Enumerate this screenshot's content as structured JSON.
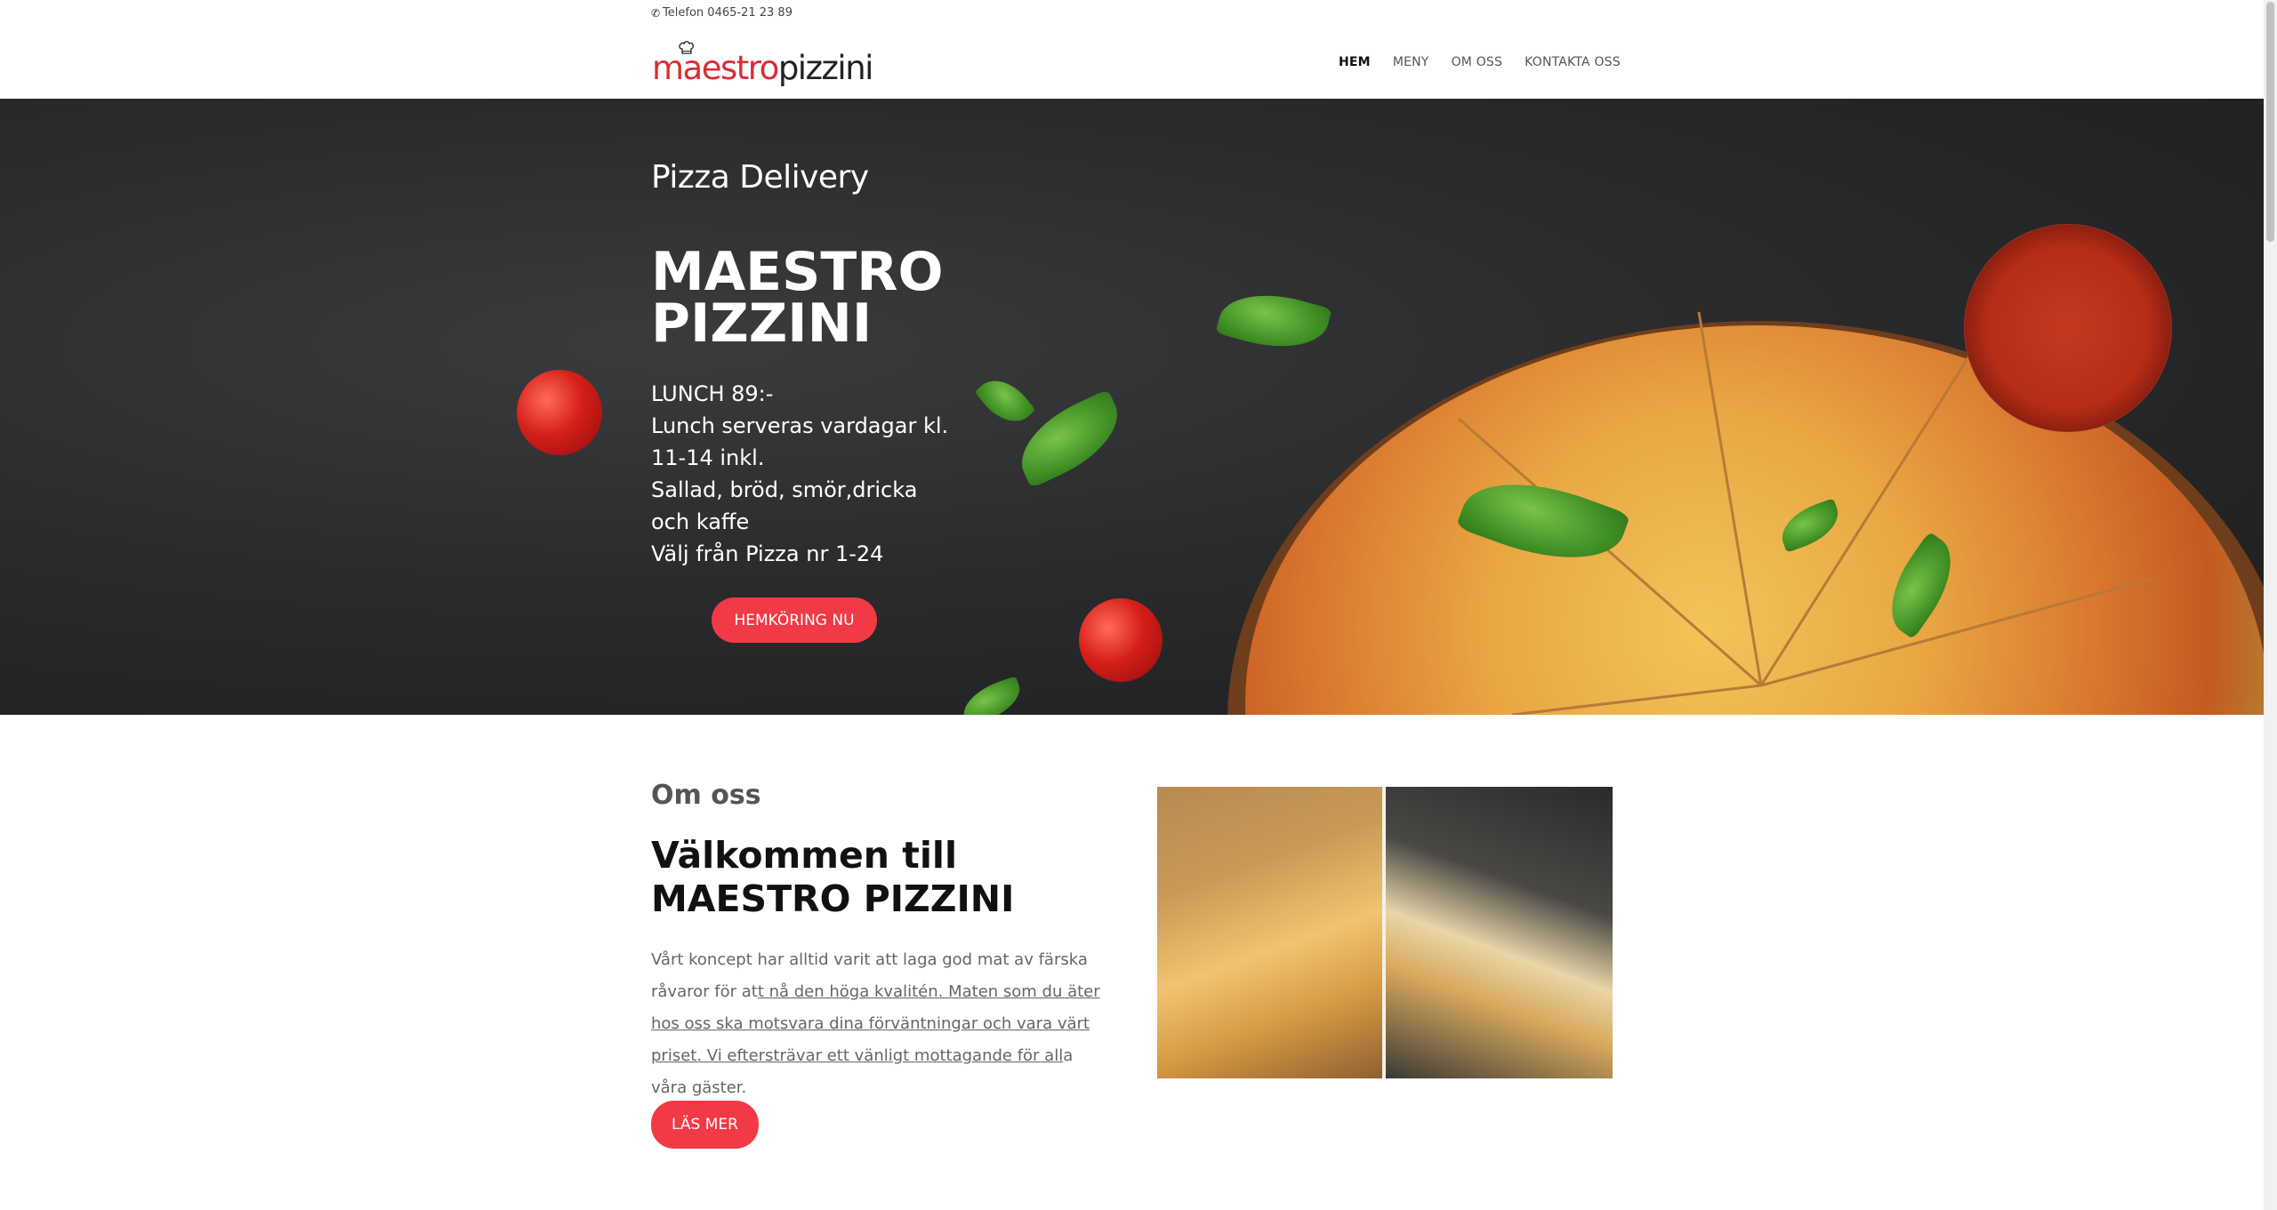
{
  "topbar": {
    "phone": "Telefon 0465-21 23 89"
  },
  "header": {
    "logo_part1": "maestro",
    "logo_part2": "pizzini",
    "nav": [
      {
        "label": "HEM",
        "active": true
      },
      {
        "label": "MENY"
      },
      {
        "label": "OM OSS"
      },
      {
        "label": "KONTAKTA OSS"
      }
    ]
  },
  "hero": {
    "subtitle": "Pizza Delivery",
    "title_line1": "MAESTRO",
    "title_line2": "PIZZINI",
    "lines": [
      "LUNCH 89:-",
      "Lunch serveras vardagar kl. 11-14 inkl.",
      "Sallad, bröd, smör,dricka och kaffe",
      "Välj från Pizza nr 1-24"
    ],
    "button": "HEMKÖRING NU"
  },
  "about": {
    "kicker": "Om oss",
    "title_line1": "Välkommen till",
    "title_line2": "MAESTRO PIZZINI",
    "text_a": "Vårt koncept har alltid varit att laga god mat av färska råvaror för at",
    "text_b": "t nå den höga kvalitén. Maten som du äter hos oss ska motsvara dina förväntningar och vara värt priset. Vi eftersträvar ett vänligt mottagande för all",
    "text_c": "a våra gäster.",
    "button": "LÄS MER"
  },
  "colors": {
    "accent": "#f13a45",
    "logo_red": "#d92d35",
    "hero_bg": "#2a2b2d"
  }
}
